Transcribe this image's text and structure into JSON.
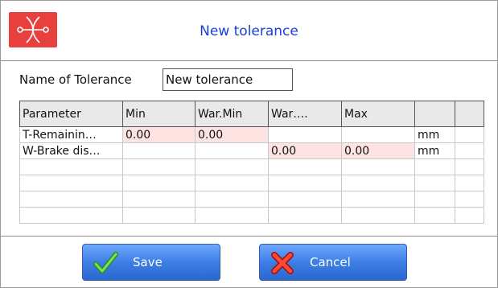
{
  "header": {
    "title": "New tolerance",
    "logo_icon": "crossed-tools-logo",
    "logo_color": "#e8403d"
  },
  "form": {
    "name_label": "Name of Tolerance",
    "name_value": "New tolerance"
  },
  "table": {
    "columns": [
      "Parameter",
      "Min",
      "War.Min",
      "War….",
      "Max",
      "",
      ""
    ],
    "rows": [
      [
        "T-Remainin…",
        "0.00",
        "0.00",
        "",
        "",
        "mm",
        ""
      ],
      [
        "W-Brake dis…",
        "",
        "",
        "0.00",
        "0.00",
        "mm",
        ""
      ],
      [
        "",
        "",
        "",
        "",
        "",
        "",
        ""
      ],
      [
        "",
        "",
        "",
        "",
        "",
        "",
        ""
      ],
      [
        "",
        "",
        "",
        "",
        "",
        "",
        ""
      ],
      [
        "",
        "",
        "",
        "",
        "",
        "",
        ""
      ]
    ]
  },
  "buttons": {
    "save_label": "Save",
    "save_icon": "checkmark-icon",
    "cancel_label": "Cancel",
    "cancel_icon": "x-cross-icon"
  },
  "colors": {
    "title": "#1a3fd6",
    "red_value": "#e23b2f",
    "orange_value": "#f0921f",
    "highlight": "#fde4e2",
    "button": "#3d7fe6"
  }
}
